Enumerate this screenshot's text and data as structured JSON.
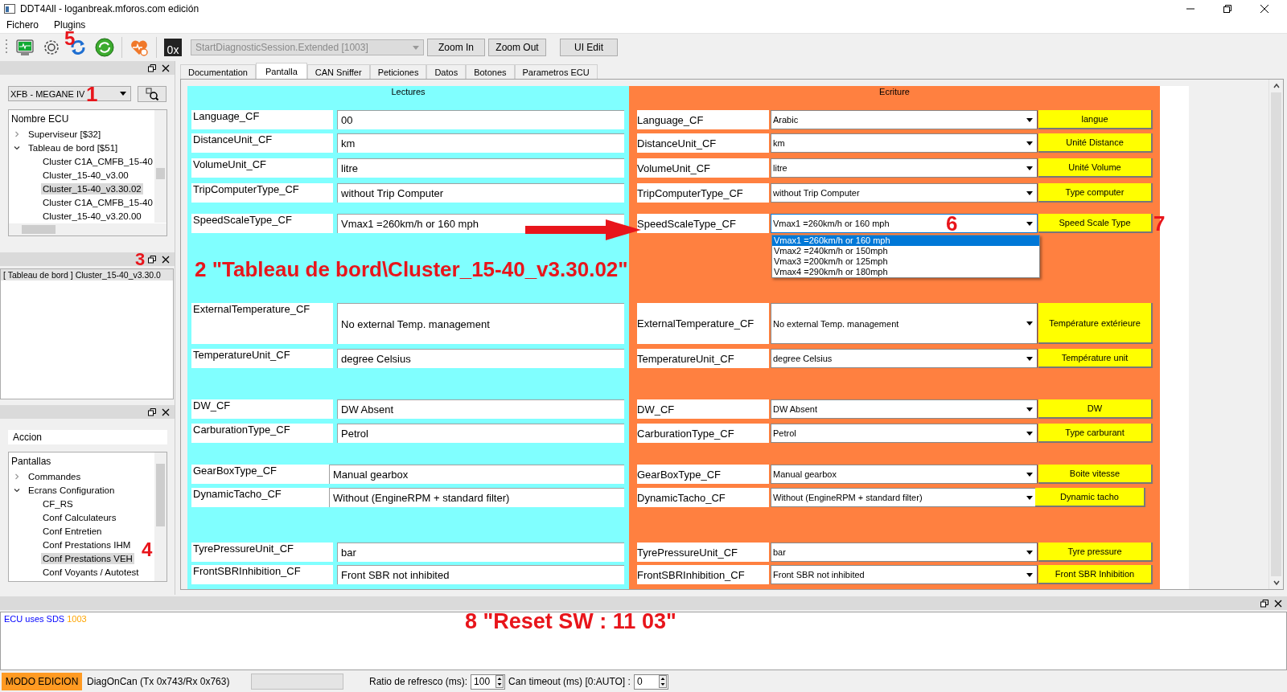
{
  "window": {
    "title": "DDT4All - loganbreak.mforos.com edición"
  },
  "menu": [
    "Fichero",
    "Plugins"
  ],
  "toolbar": {
    "hex_label": "0x",
    "session": "StartDiagnosticSession.Extended [1003]",
    "buttons": [
      "Zoom In",
      "Zoom Out",
      "UI Edit"
    ]
  },
  "ecu_panel": {
    "vehicle": "XFB - MEGANE IV",
    "tree_header": "Nombre ECU",
    "tree": [
      {
        "label": "Superviseur [$32]",
        "expanded": false,
        "selected": false
      },
      {
        "label": "Tableau de bord [$51]",
        "expanded": true,
        "selected": false,
        "children": [
          {
            "label": "Cluster C1A_CMFB_15-40",
            "selected": false
          },
          {
            "label": "Cluster_15-40_v3.00",
            "selected": false
          },
          {
            "label": "Cluster_15-40_v3.30.02",
            "selected": true
          },
          {
            "label": "Cluster C1A_CMFB_15-40",
            "selected": false
          },
          {
            "label": "Cluster_15-40_v3.20.00",
            "selected": false
          }
        ]
      }
    ]
  },
  "loaded_panel": {
    "items": [
      {
        "label": "[ Tableau de bord ] Cluster_15-40_v3.30.0",
        "selected": true
      }
    ]
  },
  "screens_panel": {
    "category": "Accion",
    "tree_header": "Pantallas",
    "tree": [
      {
        "label": "Commandes",
        "expanded": false,
        "selected": false
      },
      {
        "label": "Ecrans Configuration",
        "expanded": true,
        "selected": false,
        "children": [
          {
            "label": "CF_RS",
            "selected": false
          },
          {
            "label": "Conf Calculateurs",
            "selected": false
          },
          {
            "label": "Conf Entretien",
            "selected": false
          },
          {
            "label": "Conf Prestations IHM",
            "selected": false
          },
          {
            "label": "Conf Prestations VEH",
            "selected": true
          },
          {
            "label": "Conf Voyants / Autotest",
            "selected": false
          }
        ]
      }
    ]
  },
  "tabs": [
    {
      "label": "Documentation",
      "selected": false
    },
    {
      "label": "Pantalla",
      "selected": true
    },
    {
      "label": "CAN Sniffer",
      "selected": false
    },
    {
      "label": "Peticiones",
      "selected": false
    },
    {
      "label": "Datos",
      "selected": false
    },
    {
      "label": "Botones",
      "selected": false
    },
    {
      "label": "Parametros ECU",
      "selected": false
    }
  ],
  "screen": {
    "read_title": "Lectures",
    "write_title": "Ecriture",
    "readings": [
      {
        "label": "Language_CF",
        "value": "00"
      },
      {
        "label": "DistanceUnit_CF",
        "value": "km"
      },
      {
        "label": "VolumeUnit_CF",
        "value": "litre"
      },
      {
        "label": "TripComputerType_CF",
        "value": "without Trip Computer"
      },
      {
        "label": "SpeedScaleType_CF",
        "value": "Vmax1 =260km/h or 160 mph"
      },
      {
        "label": "ExternalTemperature_CF",
        "value": "No external Temp. management"
      },
      {
        "label": "TemperatureUnit_CF",
        "value": "degree Celsius"
      },
      {
        "label": "DW_CF",
        "value": "DW Absent"
      },
      {
        "label": "CarburationType_CF",
        "value": "Petrol"
      },
      {
        "label": "GearBoxType_CF",
        "value": "Manual gearbox"
      },
      {
        "label": "DynamicTacho_CF",
        "value": "Without (EngineRPM + standard filter)"
      },
      {
        "label": "TyrePressureUnit_CF",
        "value": "bar"
      },
      {
        "label": "FrontSBRInhibition_CF",
        "value": "Front SBR not inhibited"
      }
    ],
    "writes": [
      {
        "label": "Language_CF",
        "value": "Arabic",
        "button": "langue",
        "dropdown_open": false
      },
      {
        "label": "DistanceUnit_CF",
        "value": "km",
        "button": "Unité Distance",
        "dropdown_open": false
      },
      {
        "label": "VolumeUnit_CF",
        "value": "litre",
        "button": "Unité Volume",
        "dropdown_open": false
      },
      {
        "label": "TripComputerType_CF",
        "value": "without Trip Computer",
        "button": "Type computer",
        "dropdown_open": false
      },
      {
        "label": "SpeedScaleType_CF",
        "value": "Vmax1 =260km/h or 160 mph",
        "button": "Speed Scale Type",
        "dropdown_open": true,
        "options": [
          {
            "label": "Vmax1 =260km/h or 160 mph",
            "selected": true
          },
          {
            "label": "Vmax2 =240km/h or 150mph",
            "selected": false
          },
          {
            "label": "Vmax3 =200km/h or 125mph",
            "selected": false
          },
          {
            "label": "Vmax4 =290km/h or 180mph",
            "selected": false
          }
        ]
      },
      {
        "label": "ExternalTemperature_CF",
        "value": "No external Temp. management",
        "button": "Température extérieure",
        "dropdown_open": false
      },
      {
        "label": "TemperatureUnit_CF",
        "value": "degree Celsius",
        "button": "Température unit",
        "dropdown_open": false
      },
      {
        "label": "DW_CF",
        "value": "DW Absent",
        "button": "DW",
        "dropdown_open": false
      },
      {
        "label": "CarburationType_CF",
        "value": "Petrol",
        "button": "Type carburant",
        "dropdown_open": false
      },
      {
        "label": "GearBoxType_CF",
        "value": "Manual gearbox",
        "button": "Boite vitesse",
        "dropdown_open": false
      },
      {
        "label": "DynamicTacho_CF",
        "value": "Without (EngineRPM + standard filter)",
        "button": "Dynamic tacho",
        "dropdown_open": false
      },
      {
        "label": "TyrePressureUnit_CF",
        "value": "bar",
        "button": "Tyre pressure",
        "dropdown_open": false
      },
      {
        "label": "FrontSBRInhibition_CF",
        "value": "Front SBR not inhibited",
        "button": "Front SBR Inhibition",
        "dropdown_open": false
      }
    ]
  },
  "log": {
    "text": "ECU uses SDS",
    "value": "1003"
  },
  "status_bar": {
    "mode": "MODO EDICION",
    "connection": "DiagOnCan (Tx 0x743/Rx 0x763)",
    "refresh_label": "Ratio de refresco (ms):",
    "refresh_value": "100",
    "timeout_label": "Can timeout (ms) [0:AUTO] :",
    "timeout_value": "0"
  },
  "annotations": [
    "1",
    "2 \"Tableau de bord\\Cluster_15-40_v3.30.02\"",
    "3",
    "4",
    "5",
    "6",
    "7",
    "8 \"Reset SW : 11 03\""
  ]
}
